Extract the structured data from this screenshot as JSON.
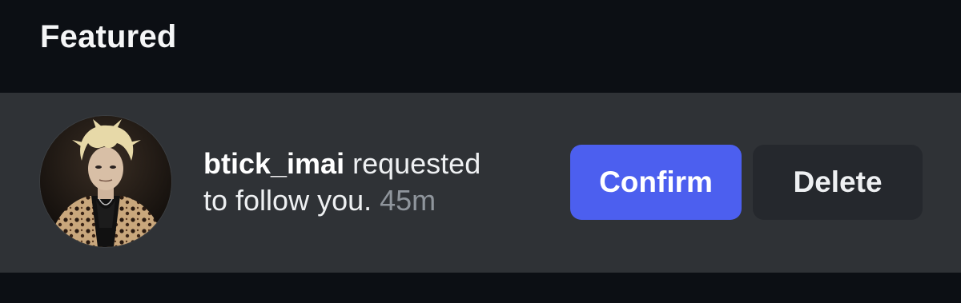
{
  "section": {
    "title": "Featured"
  },
  "follow_request": {
    "username": "btick_imai",
    "message_part1": " requested",
    "message_part2": "to follow you.",
    "time_ago": "45m",
    "avatar_icon": "profile-photo",
    "confirm_label": "Confirm",
    "delete_label": "Delete"
  },
  "colors": {
    "background": "#0c0f14",
    "row_background": "#2f3236",
    "confirm_button": "#4c5fef",
    "delete_button": "#25282d",
    "timestamp": "#8f959c"
  }
}
